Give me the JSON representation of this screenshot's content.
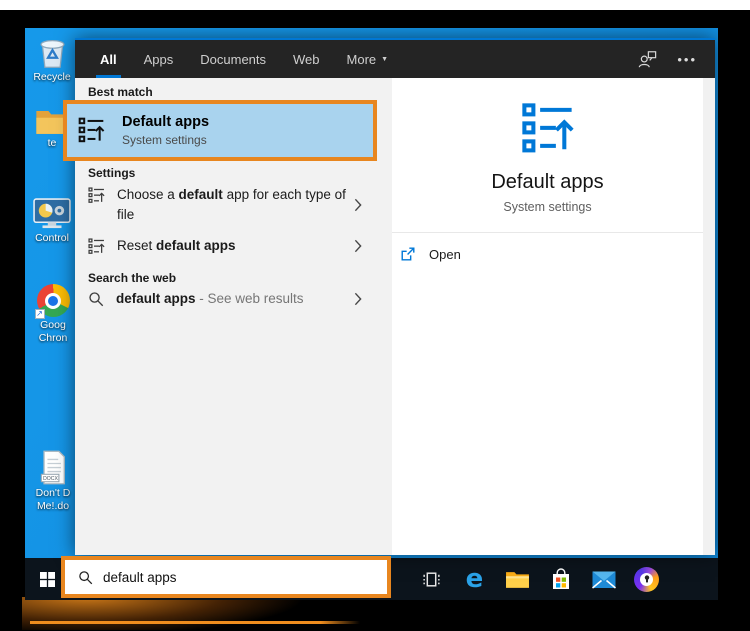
{
  "colors": {
    "annotation_orange": "#e8861f",
    "accent_blue": "#0078d7",
    "desktop_blue": "#1393e4",
    "best_match_highlight": "#a9d3ee"
  },
  "desktop": {
    "shortcut_arrow": "↗",
    "icons": [
      {
        "name": "recycle-bin",
        "label": "Recycle"
      },
      {
        "name": "folder",
        "label": "te"
      },
      {
        "name": "control-panel",
        "label": "Control"
      },
      {
        "name": "google-chrome",
        "lines": [
          "Goog",
          "Chron"
        ]
      },
      {
        "name": "docx-document",
        "badge": "DOCX",
        "lines": [
          "Don't D",
          "Me!.do"
        ]
      }
    ]
  },
  "search_window": {
    "tabs": [
      {
        "label": "All",
        "selected": true
      },
      {
        "label": "Apps"
      },
      {
        "label": "Documents"
      },
      {
        "label": "Web"
      },
      {
        "label": "More",
        "dropdown_arrow": "▼"
      }
    ],
    "header_ellipsis": "•••",
    "best_match": {
      "section_label": "Best match",
      "result": {
        "title": "Default apps",
        "subtitle": "System settings"
      }
    },
    "settings_section": {
      "section_label": "Settings",
      "rows": [
        {
          "pre": "Choose a ",
          "bold": "default",
          "post": " app for each type of file"
        },
        {
          "pre": "Reset ",
          "bold": "default apps",
          "post": ""
        }
      ]
    },
    "web_section": {
      "section_label": "Search the web",
      "rows": [
        {
          "bold": "default apps",
          "muted": " - See web results"
        }
      ]
    },
    "preview": {
      "title": "Default apps",
      "subtitle": "System settings",
      "open_label": "Open"
    }
  },
  "taskbar": {
    "search_value": "default apps",
    "edge_glyph": "e"
  }
}
